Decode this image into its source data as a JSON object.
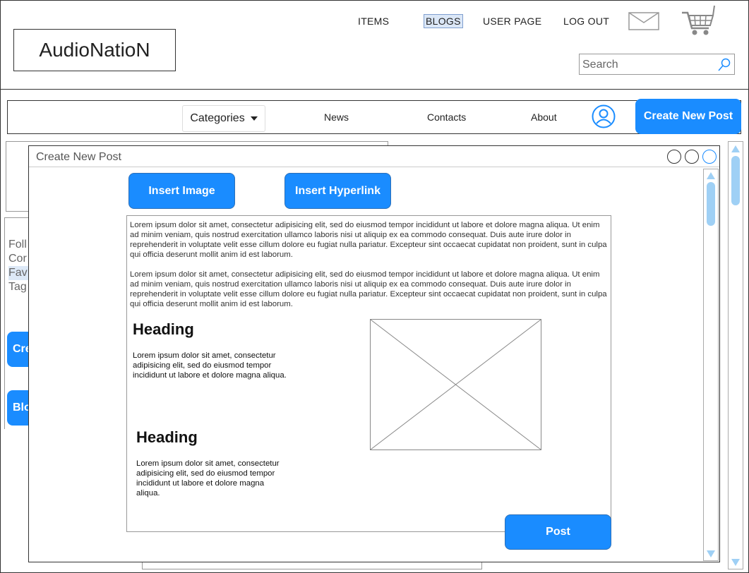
{
  "header": {
    "logo": "AudioNatioN",
    "nav": [
      {
        "label": "ITEMS"
      },
      {
        "label": "BLOGS",
        "active": true
      },
      {
        "label": "USER PAGE"
      },
      {
        "label": "LOG OUT"
      }
    ],
    "icons": [
      "mail-icon",
      "cart-icon"
    ],
    "search": {
      "placeholder": "Search",
      "value": ""
    }
  },
  "navbar": {
    "categories_label": "Categories",
    "links": [
      "News",
      "Contacts",
      "About"
    ],
    "user_icon": "user-icon",
    "create_post_label": "Create New Post"
  },
  "background": {
    "sidebar_items": [
      "Foll",
      "Cor",
      "Fav",
      "Tag"
    ],
    "buttons": [
      "Cre",
      "Blo"
    ]
  },
  "modal": {
    "title": "Create New Post",
    "insert_image_label": "Insert Image",
    "insert_hyperlink_label": "Insert Hyperlink",
    "paragraphs": [
      "Lorem ipsum dolor sit amet, consectetur adipisicing elit, sed do eiusmod tempor incididunt ut labore et dolore magna aliqua. Ut enim ad minim veniam, quis nostrud exercitation ullamco laboris nisi ut aliquip ex ea commodo consequat. Duis aute irure dolor in reprehenderit in voluptate velit esse cillum dolore eu fugiat nulla pariatur. Excepteur sint occaecat cupidatat non proident, sunt in culpa qui officia deserunt mollit anim id est laborum.",
      "Lorem ipsum dolor sit amet, consectetur adipisicing elit, sed do eiusmod tempor incididunt ut labore et dolore magna aliqua. Ut enim ad minim veniam, quis nostrud exercitation ullamco laboris nisi ut aliquip ex ea commodo consequat. Duis aute irure dolor in reprehenderit in voluptate velit esse cillum dolore eu fugiat nulla pariatur. Excepteur sint occaecat cupidatat non proident, sunt in culpa qui officia deserunt mollit anim id est laborum."
    ],
    "sections": [
      {
        "heading": "Heading",
        "text": "Lorem ipsum dolor sit amet, consectetur adipisicing elit, sed do eiusmod tempor incididunt ut labore et dolore magna aliqua."
      },
      {
        "heading": "Heading",
        "text": "Lorem ipsum dolor sit amet, consectetur adipisicing elit, sed do eiusmod tempor incididunt ut labore et dolore magna aliqua."
      }
    ],
    "post_label": "Post"
  },
  "colors": {
    "accent": "#1a8cff",
    "scroll": "#9fd0f5",
    "active_tab_bg": "#dbe7f7"
  }
}
